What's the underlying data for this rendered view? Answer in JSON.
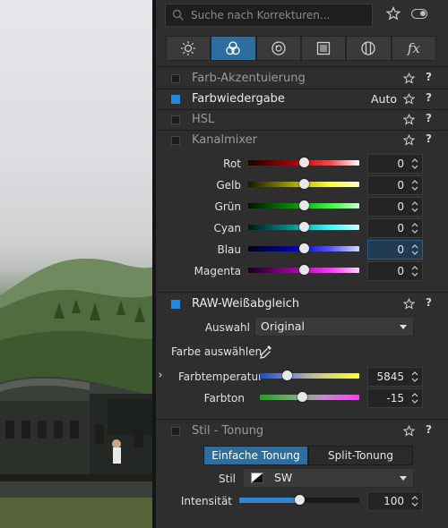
{
  "search": {
    "placeholder": "Suche nach Korrekturen..."
  },
  "tabs": [
    {
      "icon": "sun-icon",
      "active": false
    },
    {
      "icon": "color-circles-icon",
      "active": true
    },
    {
      "icon": "lens-icon",
      "active": false
    },
    {
      "icon": "frame-icon",
      "active": false
    },
    {
      "icon": "filter-dial-icon",
      "active": false
    },
    {
      "icon": "fx-icon",
      "label": "fx",
      "active": false
    }
  ],
  "sections": {
    "farb_akzent": {
      "title": "Farb-Akzentuierung",
      "enabled": false
    },
    "farbwiedergabe": {
      "title": "Farbwiedergabe",
      "extra": "Auto",
      "enabled": true
    },
    "hsl": {
      "title": "HSL",
      "enabled": false
    },
    "kanalmixer": {
      "title": "Kanalmixer",
      "enabled": false,
      "rows": [
        {
          "label": "Rot",
          "value": "0",
          "fraction": 0.5
        },
        {
          "label": "Gelb",
          "value": "0",
          "fraction": 0.5
        },
        {
          "label": "Grün",
          "value": "0",
          "fraction": 0.5
        },
        {
          "label": "Cyan",
          "value": "0",
          "fraction": 0.5
        },
        {
          "label": "Blau",
          "value": "0",
          "fraction": 0.5
        },
        {
          "label": "Magenta",
          "value": "0",
          "fraction": 0.5
        }
      ]
    },
    "raw_wb": {
      "title": "RAW-Weißabgleich",
      "enabled": true,
      "auswahl_label": "Auswahl",
      "auswahl_value": "Original",
      "pick_label": "Farbe auswählen",
      "temp_label": "Farbtemperatur",
      "temp_value": "5845 K",
      "temp_fraction": 0.27,
      "tint_label": "Farbton",
      "tint_value": "-15",
      "tint_fraction": 0.42
    },
    "stil_tonung": {
      "title": "Stil - Tonung",
      "enabled": false,
      "seg_left": "Einfache Tonung",
      "seg_right": "Split-Tonung",
      "stil_label": "Stil",
      "stil_value": "SW",
      "intensity_label": "Intensität",
      "intensity_value": "100",
      "intensity_fraction": 0.5
    }
  },
  "help_label": "?",
  "collapse_arrow": "›",
  "colors": {
    "accent": "#2d6e9e",
    "checkbox_on": "#1f8be0",
    "panel": "#2e2e2e"
  }
}
